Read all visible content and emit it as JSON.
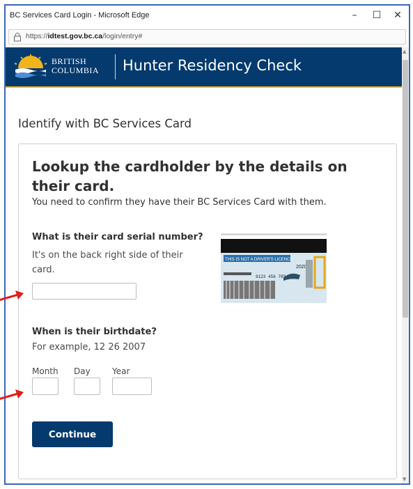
{
  "window": {
    "title": "BC Services Card Login - Microsoft Edge",
    "controls": {
      "minimize": "–",
      "maximize": "☐",
      "close": "✕"
    },
    "url_prefix": "https://",
    "url_host": "idtest.gov.bc.ca",
    "url_path": "/login/entry#"
  },
  "header": {
    "logo_line1": "BRITISH",
    "logo_line2": "COLUMBIA",
    "app_title": "Hunter Residency Check",
    "bg_color": "#053a6e",
    "accent_color": "#f2b41c"
  },
  "page": {
    "heading": "Identify with BC Services Card"
  },
  "card": {
    "title": "Lookup the cardholder by the details on their card.",
    "intro": "You need to confirm they have their BC Services Card with them.",
    "serial_question": "What is their card serial number?",
    "serial_hint": "It's on the back right side of their card.",
    "serial_value": "",
    "image_alt_icon": "bc-services-card-back-icon",
    "image_text": {
      "banner": "THIS IS NOT A DRIVER'S LICENCE",
      "year": "2020",
      "number": "9123 456 789"
    },
    "birth_question": "When is their birthdate?",
    "birth_hint": "For example, 12 26 2007",
    "month_label": "Month",
    "day_label": "Day",
    "year_label": "Year",
    "month_value": "",
    "day_value": "",
    "year_value": "",
    "continue_label": "Continue"
  },
  "annotations": {
    "arrow_color": "#e0201b"
  }
}
